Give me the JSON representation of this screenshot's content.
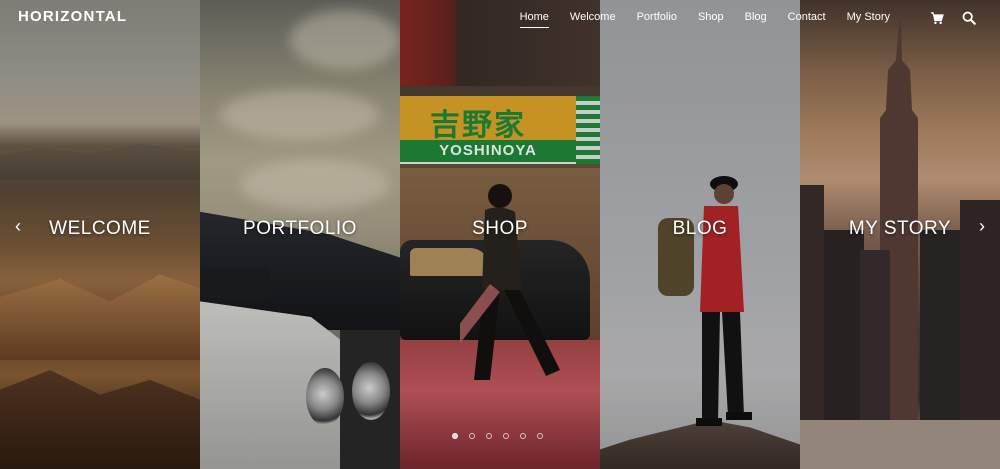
{
  "brand": {
    "logo": "HORIZONTAL"
  },
  "nav": {
    "items": [
      {
        "label": "Home",
        "active": true
      },
      {
        "label": "Welcome",
        "active": false
      },
      {
        "label": "Portfolio",
        "active": false
      },
      {
        "label": "Shop",
        "active": false
      },
      {
        "label": "Blog",
        "active": false
      },
      {
        "label": "Contact",
        "active": false
      },
      {
        "label": "My Story",
        "active": false
      }
    ],
    "icons": [
      "cart-icon",
      "search-icon"
    ]
  },
  "panels": [
    {
      "label": "WELCOME",
      "image": "canyon"
    },
    {
      "label": "PORTFOLIO",
      "image": "classic-car"
    },
    {
      "label": "SHOP",
      "image": "tokyo-street"
    },
    {
      "label": "BLOG",
      "image": "hiker"
    },
    {
      "label": "MY STORY",
      "image": "city-skyline"
    }
  ],
  "scene_text": {
    "shop_sign_jp": "吉野家",
    "shop_sign_en": "YOSHINOYA"
  },
  "slider": {
    "dot_count": 6,
    "active_dot": 0
  }
}
